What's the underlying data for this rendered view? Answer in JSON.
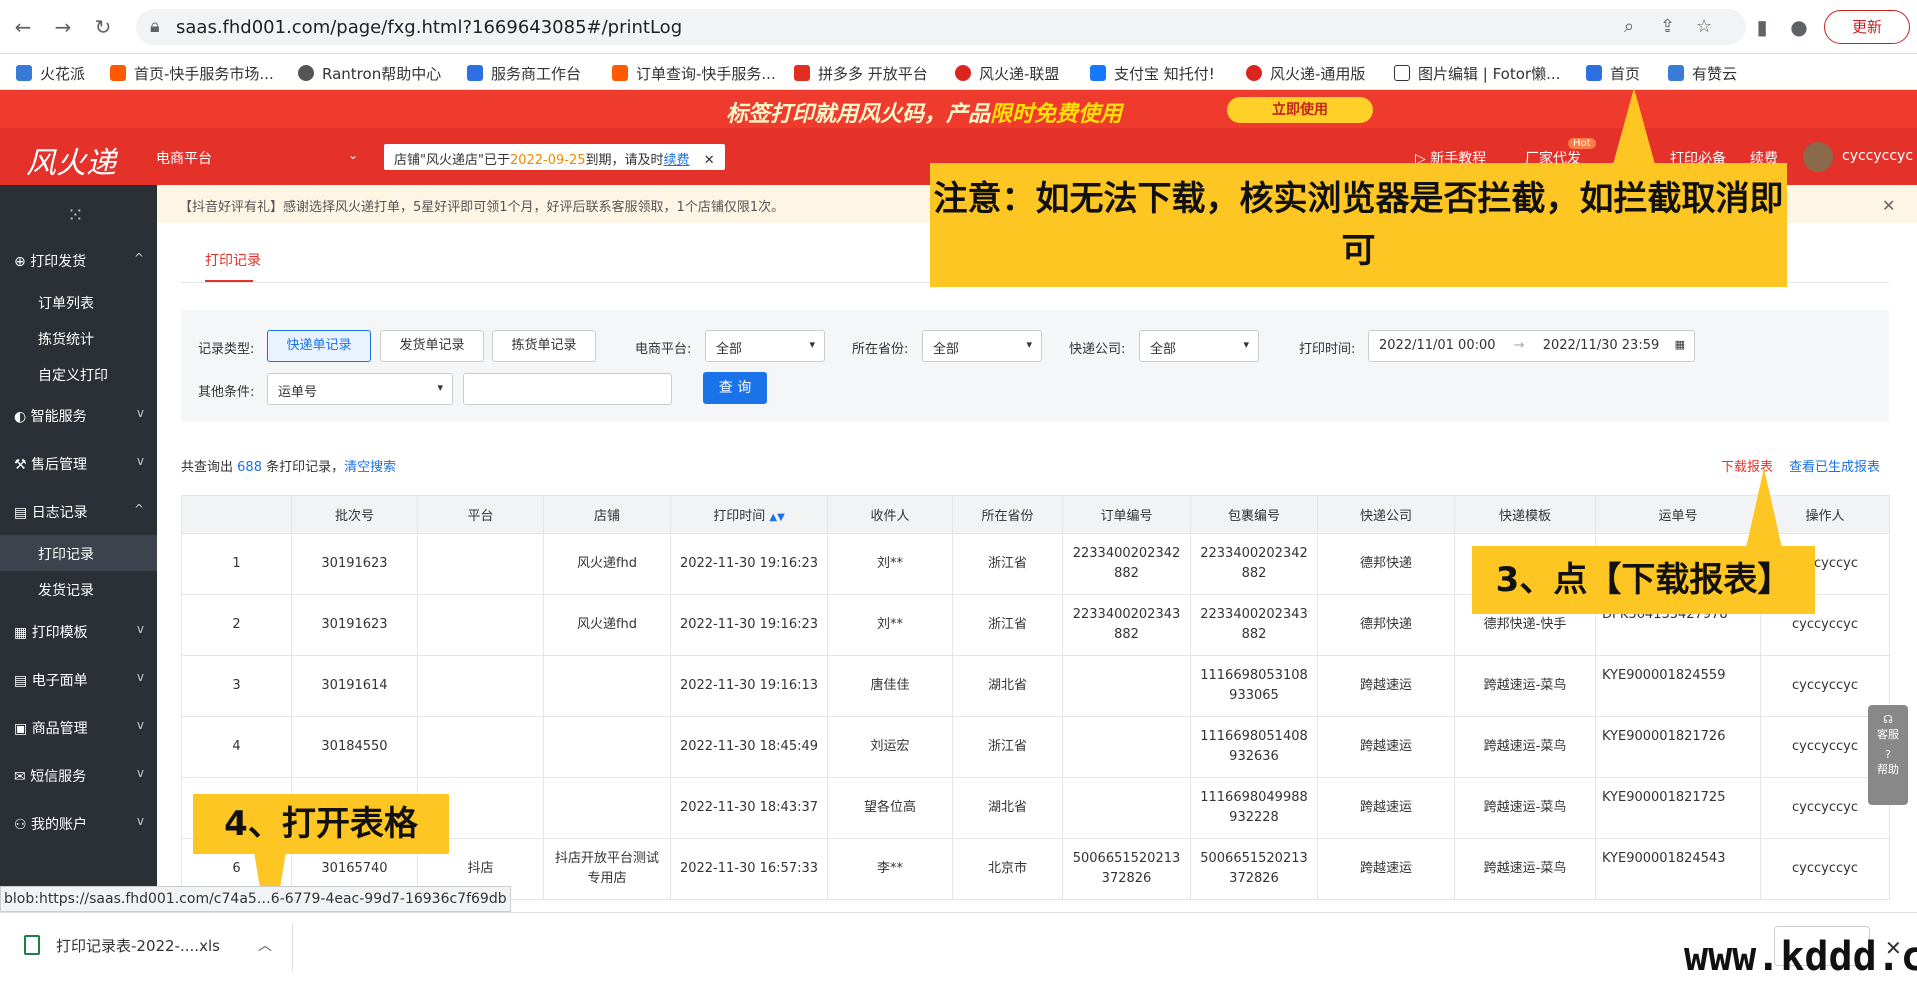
{
  "browser": {
    "url": "saas.fhd001.com/page/fxg.html?1669643085#/printLog",
    "update_label": "更新",
    "bookmarks": [
      "火花派",
      "首页-快手服务市场...",
      "Rantron帮助中心",
      "服务商工作台",
      "订单查询-快手服务...",
      "拼多多 开放平台",
      "风火递-联盟",
      "支付宝 知托付!",
      "风火递-通用版",
      "图片编辑 | Fotor懒...",
      "首页",
      "有赞云"
    ]
  },
  "promo": {
    "text_a": "标签打印就用风火码，产品",
    "text_b": "限时免费使用",
    "button": "立即使用"
  },
  "header": {
    "logo": "风火递",
    "platform": "电商平台",
    "shop_notice_a": "店铺\"风火递店\"已于",
    "shop_notice_date": "2022-09-25",
    "shop_notice_b": "到期，请及时",
    "shop_notice_link": "续费",
    "items": [
      "新手教程",
      "厂家代发",
      "打印必备",
      "续费"
    ],
    "hot": "Hot",
    "user": "cyccyccyc"
  },
  "sidebar": {
    "sections": [
      {
        "label": "打印发货",
        "chev": "^"
      },
      {
        "label": "智能服务",
        "chev": "v"
      },
      {
        "label": "售后管理",
        "chev": "v"
      },
      {
        "label": "日志记录",
        "chev": "^"
      },
      {
        "label": "打印模板",
        "chev": "v"
      },
      {
        "label": "电子面单",
        "chev": "v"
      },
      {
        "label": "商品管理",
        "chev": "v"
      },
      {
        "label": "短信服务",
        "chev": "v"
      },
      {
        "label": "我的账户",
        "chev": "v"
      }
    ],
    "subs": [
      "订单列表",
      "拣货统计",
      "自定义打印",
      "打印记录",
      "发货记录"
    ]
  },
  "notice": "【抖音好评有礼】感谢选择风火递打单，5星好评即可领1个月，好评后联系客服领取，1个店铺仅限1次。",
  "tab": "打印记录",
  "filter": {
    "record_type_label": "记录类型:",
    "types": [
      "快递单记录",
      "发货单记录",
      "拣货单记录"
    ],
    "platform_label": "电商平台:",
    "platform_value": "全部",
    "province_label": "所在省份:",
    "province_value": "全部",
    "express_label": "快递公司:",
    "express_value": "全部",
    "time_label": "打印时间:",
    "time_start": "2022/11/01 00:00",
    "time_arrow": "→",
    "time_end": "2022/11/30 23:59",
    "other_label": "其他条件:",
    "other_value": "运单号",
    "search_button": "查 询"
  },
  "summary": {
    "prefix": "共查询出",
    "count": "688",
    "suffix": "条打印记录，",
    "clear": "清空搜索",
    "download": "下载报表",
    "view": "查看已生成报表"
  },
  "table": {
    "headers": [
      "",
      "批次号",
      "平台",
      "店铺",
      "打印时间",
      "收件人",
      "所在省份",
      "订单编号",
      "包裹编号",
      "快递公司",
      "快递模板",
      "运单号",
      "操作人"
    ],
    "rows": [
      [
        "1",
        "30191623",
        "",
        "风火递fhd",
        "2022-11-30 19:16:23",
        "刘**",
        "浙江省",
        "2233400202342882",
        "2233400202342882",
        "德邦快递",
        "",
        "",
        "cyccyccyc"
      ],
      [
        "2",
        "30191623",
        "",
        "风火递fhd",
        "2022-11-30 19:16:23",
        "刘**",
        "浙江省",
        "2233400202343882",
        "2233400202343882",
        "德邦快递",
        "德邦快递-快手",
        "DPK364133427978",
        "cyccyccyc"
      ],
      [
        "3",
        "30191614",
        "",
        "",
        "2022-11-30 19:16:13",
        "唐佳佳",
        "湖北省",
        "",
        "1116698053108933065",
        "跨越速运",
        "跨越速运-菜鸟",
        "KYE900001824559",
        "cyccyccyc"
      ],
      [
        "4",
        "30184550",
        "",
        "",
        "2022-11-30 18:45:49",
        "刘运宏",
        "浙江省",
        "",
        "1116698051408932636",
        "跨越速运",
        "跨越速运-菜鸟",
        "KYE900001821726",
        "cyccyccyc"
      ],
      [
        "5",
        "",
        "",
        "",
        "2022-11-30 18:43:37",
        "望各位高",
        "湖北省",
        "",
        "1116698049988932228",
        "跨越速运",
        "跨越速运-菜鸟",
        "KYE900001821725",
        "cyccyccyc"
      ],
      [
        "6",
        "30165740",
        "抖店",
        "抖店开放平台测试专用店",
        "2022-11-30 16:57:33",
        "李**",
        "北京市",
        "5006651520213372826",
        "5006651520213372826",
        "跨越速运",
        "跨越速运-菜鸟",
        "KYE900001824543",
        "cyccyccyc"
      ]
    ]
  },
  "callouts": {
    "c1": "注意：如无法下载，核实浏览器是否拦截，如拦截取消即可",
    "c2": "3、点【下载报表】",
    "c3": "4、打开表格"
  },
  "float": {
    "service": "客服",
    "help": "帮助"
  },
  "status_url": "blob:https://saas.fhd001.com/c74a5…6-6779-4eac-99d7-16936c7f69db",
  "download": {
    "file": "打印记录表-2022-....xls"
  },
  "watermark": "www.kddd.cn",
  "colors": {
    "brand_red": "#e4322b",
    "callout_yellow": "#fdc623",
    "link_blue": "#1a73e8"
  }
}
